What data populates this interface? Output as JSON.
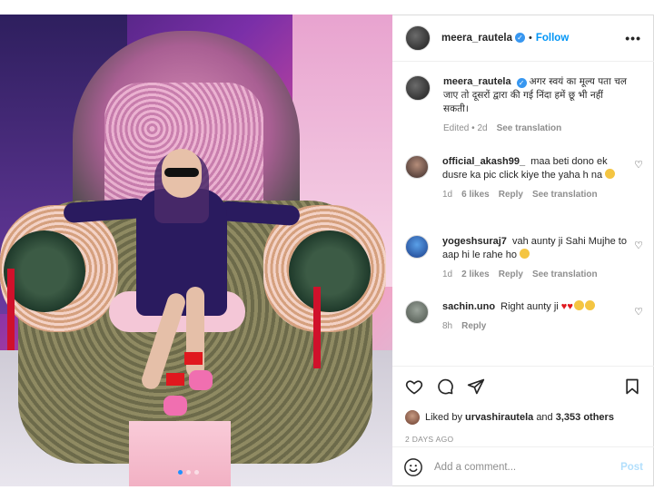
{
  "post": {
    "author": "meera_rautela",
    "follow_label": "Follow",
    "more_icon": "more-horizontal-icon",
    "caption": "अगर स्वयं का मूल्य पता चल जाए तो दूसरों द्वारा की गई निंदा हमें छू भी नहीं सकती।",
    "caption_meta": {
      "edited": "Edited",
      "age": "2d",
      "see_translation": "See translation"
    },
    "separator": "•"
  },
  "comments": [
    {
      "user": "official_akash99_",
      "text": "maa beti dono ek dusre ka pic click kiye the yaha h na",
      "age": "1d",
      "likes": "6 likes",
      "reply": "Reply",
      "see_translation": "See translation",
      "emoji": "thinking-face-emoji"
    },
    {
      "user": "yogeshsuraj7",
      "text": "vah aunty ji Sahi Mujhe to aap hi le rahe ho",
      "age": "1d",
      "likes": "2 likes",
      "reply": "Reply",
      "see_translation": "See translation",
      "emoji": "grinning-face-emoji"
    },
    {
      "user": "sachin.uno",
      "text": "Right aunty ji",
      "age": "8h",
      "reply": "Reply",
      "emoji": "hearts-and-ok-hands-emoji"
    }
  ],
  "actions": {
    "icons": [
      "heart-icon",
      "comment-icon",
      "share-icon",
      "bookmark-icon"
    ]
  },
  "likes": {
    "prefix": "Liked by",
    "user": "urvashirautela",
    "and": "and",
    "others": "3,353 others"
  },
  "timestamp": "2 DAYS AGO",
  "add_comment": {
    "placeholder": "Add a comment...",
    "post_label": "Post"
  },
  "carousel": {
    "total": 3,
    "active": 1
  },
  "colors": {
    "link": "#0095f6",
    "verified": "#3897f0",
    "muted": "#8e8e8e",
    "heart_red": "#e0181e"
  }
}
